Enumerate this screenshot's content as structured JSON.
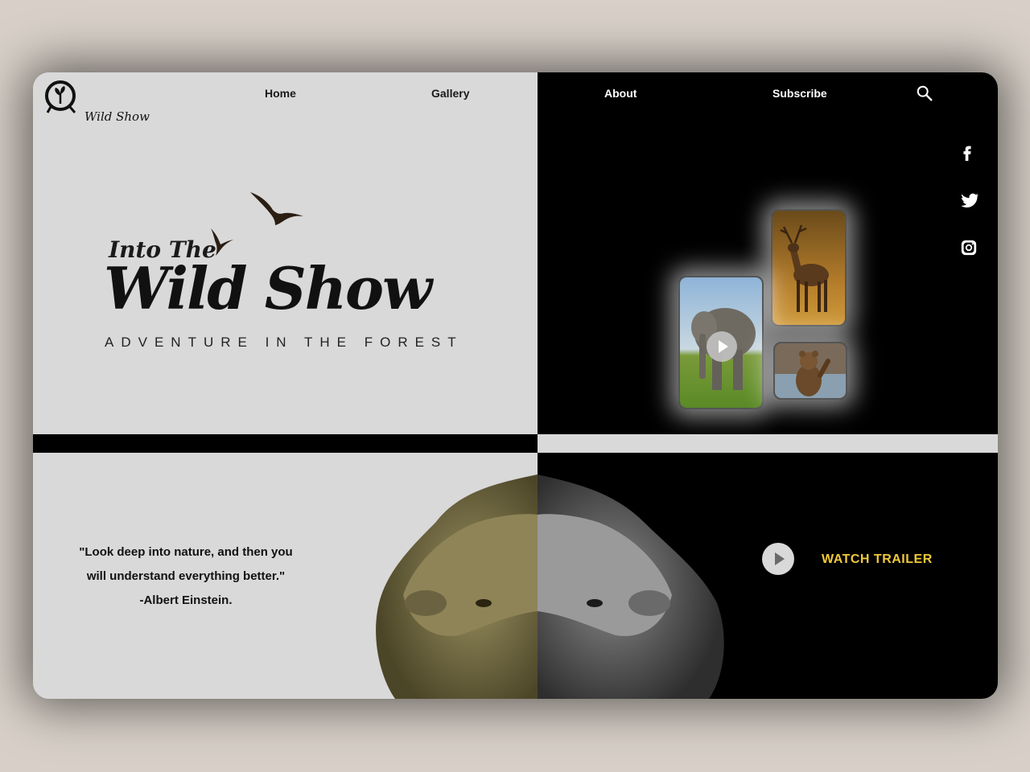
{
  "brand": {
    "logo_text": "Wild Show"
  },
  "nav": {
    "home": "Home",
    "gallery": "Gallery",
    "about": "About",
    "subscribe": "Subscribe"
  },
  "hero": {
    "subtitle": "Into The",
    "title": "Wild Show",
    "tagline": "ADVENTURE IN THE FOREST"
  },
  "social": [
    "facebook-icon",
    "twitter-icon",
    "instagram-icon"
  ],
  "gallery_cards": [
    "elephant",
    "deer",
    "bear"
  ],
  "quote": {
    "line1": "\"Look deep into nature, and then you",
    "line2": "will understand everything better.\"",
    "author": "-Albert Einstein."
  },
  "trailer": {
    "label": "WATCH TRAILER"
  },
  "colors": {
    "light_panel": "#d9d9d9",
    "dark_panel": "#000000",
    "accent": "#f0c83a",
    "page_bg": "#d8d0c8"
  }
}
